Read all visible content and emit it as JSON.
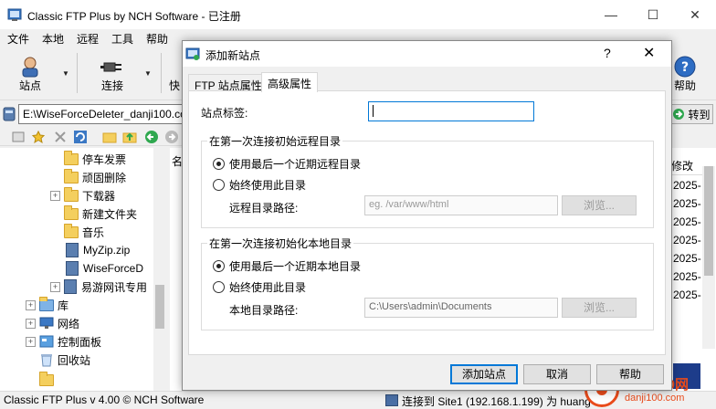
{
  "window": {
    "title": "Classic FTP Plus by NCH Software - 已注册"
  },
  "menu": [
    "文件",
    "本地",
    "远程",
    "工具",
    "帮助"
  ],
  "toolbar": {
    "site_label": "站点",
    "connect_label": "连接",
    "quick_label": "快",
    "help_label": "帮助"
  },
  "address": {
    "value": "E:\\WiseForceDeleter_danji100.com.",
    "goto_label": "转到"
  },
  "tree": {
    "items": [
      {
        "label": "停车发票",
        "kind": "folder"
      },
      {
        "label": "顽固删除",
        "kind": "folder"
      },
      {
        "label": "下载器",
        "kind": "folder"
      },
      {
        "label": "新建文件夹",
        "kind": "folder"
      },
      {
        "label": "音乐",
        "kind": "folder"
      },
      {
        "label": "MyZip.zip",
        "kind": "zip"
      },
      {
        "label": "WiseForceD",
        "kind": "zip"
      },
      {
        "label": "易游网讯专用",
        "kind": "folder"
      },
      {
        "label": "库",
        "kind": "folder"
      },
      {
        "label": "网络",
        "kind": "network"
      },
      {
        "label": "控制面板",
        "kind": "control"
      },
      {
        "label": "回收站",
        "kind": "recycle"
      }
    ]
  },
  "file_list": {
    "name_header": "名",
    "modified_header": "修改",
    "dates": [
      "2025-",
      "2025-",
      "2025-",
      "2025-",
      "2025-",
      "2025-",
      "2025-"
    ]
  },
  "status": {
    "left": "Classic FTP Plus v 4.00 © NCH Software",
    "right": "连接到 Site1 (192.168.1.199) 为 huang"
  },
  "watermark": {
    "line1": "单机100网",
    "line2": "danji100.com"
  },
  "dialog": {
    "title": "添加新站点",
    "help_glyph": "?",
    "close_glyph": "✕",
    "tabs": [
      {
        "label": "FTP 站点属性",
        "active": false
      },
      {
        "label": "高级属性",
        "active": true
      }
    ],
    "site_label_caption": "站点标签:",
    "site_label_value": "",
    "remote_group": {
      "title": "在第一次连接初始远程目录",
      "option_last": "使用最后一个近期远程目录",
      "option_fixed": "始终使用此目录",
      "selected": "last",
      "path_caption": "远程目录路径:",
      "path_placeholder": "eg. /var/www/html",
      "browse_label": "浏览..."
    },
    "local_group": {
      "title": "在第一次连接初始化本地目录",
      "option_last": "使用最后一个近期本地目录",
      "option_fixed": "始终使用此目录",
      "selected": "last",
      "path_caption": "本地目录路径:",
      "path_value": "C:\\Users\\admin\\Documents",
      "browse_label": "浏览..."
    },
    "buttons": {
      "add": "添加站点",
      "cancel": "取消",
      "help": "帮助"
    }
  },
  "colors": {
    "accent": "#0078d7",
    "folder": "#f4cf5e",
    "watermark": "#e94b1b"
  }
}
